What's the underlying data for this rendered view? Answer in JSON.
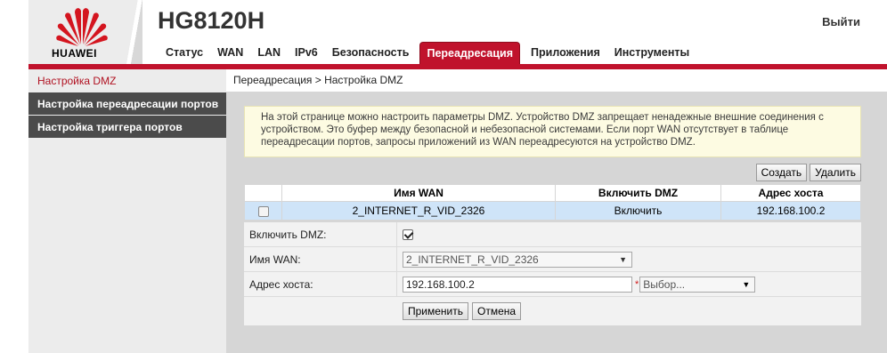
{
  "header": {
    "brand": "HUAWEI",
    "model": "HG8120H",
    "logout_label": "Выйти",
    "brand_color": "#c0122c"
  },
  "nav": {
    "tabs": [
      "Статус",
      "WAN",
      "LAN",
      "IPv6",
      "Безопасность",
      "Переадресация",
      "Приложения",
      "Инструменты"
    ],
    "active": "Переадресация"
  },
  "sidebar": {
    "items": [
      {
        "label": "Настройка DMZ",
        "active": true
      },
      {
        "label": "Настройка переадресации портов",
        "active": false
      },
      {
        "label": "Настройка триггера портов",
        "active": false
      }
    ]
  },
  "breadcrumb": "Переадресация > Настройка DMZ",
  "notice": "На этой странице можно настроить параметры DMZ. Устройство DMZ запрещает ненадежные внешние соединения с устройством. Это буфер между безопасной и небезопасной системами. Если порт WAN отсутствует в таблице переадресации портов, запросы приложений из WAN переадресуются на устройство DMZ.",
  "actions": {
    "create_label": "Создать",
    "delete_label": "Удалить"
  },
  "table": {
    "headers": [
      "",
      "Имя WAN",
      "Включить DMZ",
      "Адрес хоста"
    ],
    "rows": [
      {
        "wan_name": "2_INTERNET_R_VID_2326",
        "enable": "Включить",
        "host": "192.168.100.2"
      }
    ]
  },
  "form": {
    "enable_label": "Включить DMZ:",
    "enable_checked": true,
    "wan_label": "Имя WAN:",
    "wan_value": "2_INTERNET_R_VID_2326",
    "host_label": "Адрес хоста:",
    "host_value": "192.168.100.2",
    "required_mark": "*",
    "host_select_value": "Выбор...",
    "apply_label": "Применить",
    "cancel_label": "Отмена"
  }
}
